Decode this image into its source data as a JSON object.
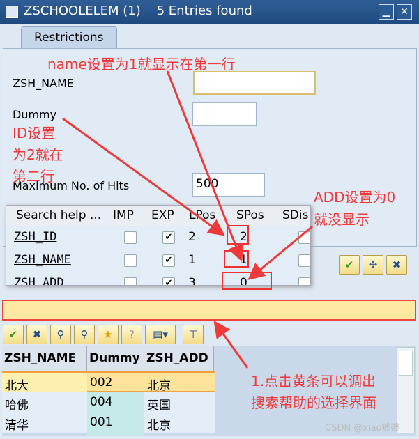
{
  "window": {
    "title": "ZSCHOOLELEM (1)    5 Entries found",
    "minimize": "▁",
    "close": "✕"
  },
  "tab": "Restrictions",
  "fields": {
    "name_label": "ZSH_NAME",
    "dummy_label": "Dummy",
    "maxhits_label": "Maximum No. of Hits",
    "maxhits_value": "500"
  },
  "popup": {
    "columns": [
      "Search help ...",
      "IMP",
      "EXP",
      "LPos",
      "SPos",
      "SDis"
    ],
    "rows": [
      {
        "name": "ZSH_ID",
        "imp": false,
        "exp": true,
        "lpos": "2",
        "spos": "2"
      },
      {
        "name": "ZSH_NAME",
        "imp": false,
        "exp": true,
        "lpos": "1",
        "spos": "1"
      },
      {
        "name": "ZSH_ADD",
        "imp": false,
        "exp": true,
        "lpos": "3",
        "spos": "0"
      }
    ]
  },
  "grid": {
    "columns": [
      "ZSH_NAME",
      "Dummy",
      "ZSH_ADD"
    ],
    "rows": [
      [
        "北大",
        "002",
        "北京"
      ],
      [
        "哈佛",
        "004",
        "英国"
      ],
      [
        "清华",
        "001",
        "北京"
      ]
    ]
  },
  "annotations": {
    "a1": "name设置为1就显示在第一行",
    "a2a": "ID设置",
    "a2b": "为2就在",
    "a2c": "第二行",
    "a3a": "ADD设置为0",
    "a3b": "就没显示",
    "a4a": "1.点击黄条可以调出",
    "a4b": "搜索帮助的选择界面"
  },
  "watermark": "CSDN @xiao贱贱",
  "colors": {
    "title_bar": "#1f4a80",
    "annotation": "#f03a3a",
    "yellow_bar": "#fee8a2"
  }
}
